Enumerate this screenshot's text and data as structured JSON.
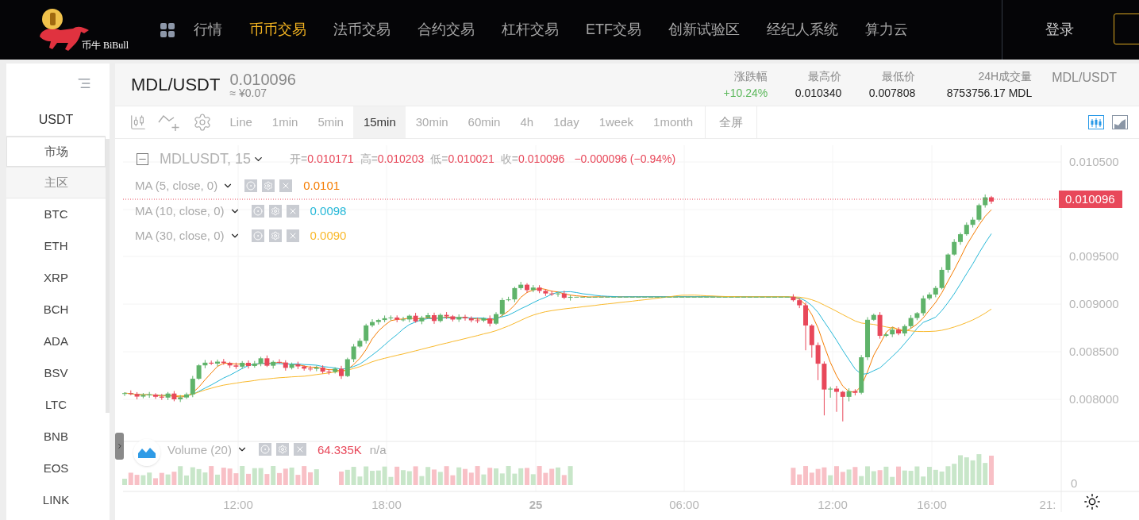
{
  "header": {
    "logo_text": "币牛 BiBull",
    "nav": [
      {
        "label": "行情",
        "selected": false
      },
      {
        "label": "币币交易",
        "selected": true
      },
      {
        "label": "法币交易",
        "selected": false
      },
      {
        "label": "合约交易",
        "selected": false
      },
      {
        "label": "杠杆交易",
        "selected": false
      },
      {
        "label": "ETF交易",
        "selected": false
      },
      {
        "label": "创新试验区",
        "selected": false
      },
      {
        "label": "经纪人系统",
        "selected": false
      },
      {
        "label": "算力云",
        "selected": false
      }
    ],
    "login": "登录"
  },
  "sidebar": {
    "quote": "USDT",
    "tabs": [
      {
        "label": "市场",
        "selected": true
      },
      {
        "label": "主区",
        "selected": false
      }
    ],
    "coins": [
      "BTC",
      "ETH",
      "XRP",
      "BCH",
      "ADA",
      "BSV",
      "LTC",
      "BNB",
      "EOS",
      "LINK"
    ]
  },
  "ticker": {
    "pair": "MDL/USDT",
    "price": "0.010096",
    "approx": "≈ ¥0.07",
    "stats": [
      {
        "label": "涨跌幅",
        "value": "+10.24%",
        "kind": "change"
      },
      {
        "label": "最高价",
        "value": "0.010340",
        "kind": "plain"
      },
      {
        "label": "最低价",
        "value": "0.007808",
        "kind": "plain"
      },
      {
        "label": "24H成交量",
        "value": "8753756.17 MDL",
        "kind": "plain"
      }
    ],
    "pair_label": "MDL/USDT"
  },
  "toolbar": {
    "intervals": [
      {
        "label": "Line",
        "selected": false
      },
      {
        "label": "1min",
        "selected": false
      },
      {
        "label": "5min",
        "selected": false
      },
      {
        "label": "15min",
        "selected": true
      },
      {
        "label": "30min",
        "selected": false
      },
      {
        "label": "60min",
        "selected": false
      },
      {
        "label": "4h",
        "selected": false
      },
      {
        "label": "1day",
        "selected": false
      },
      {
        "label": "1week",
        "selected": false
      },
      {
        "label": "1month",
        "selected": false
      }
    ],
    "fullscreen": "全屏",
    "chart_styles": [
      {
        "kind": "candles",
        "selected": true
      },
      {
        "kind": "area",
        "selected": false
      }
    ]
  },
  "chart": {
    "symbol": "MDLUSDT, 15",
    "ohlc": [
      {
        "label": "开=",
        "value": "0.010171"
      },
      {
        "label": "高=",
        "value": "0.010203"
      },
      {
        "label": "低=",
        "value": "0.010021"
      },
      {
        "label": "收=",
        "value": "0.010096"
      }
    ],
    "change": "−0.000096 (−0.94%)",
    "indicators": [
      {
        "label": "MA (5, close, 0)",
        "value": "0.0101",
        "color": "#f57c00"
      },
      {
        "label": "MA (10, close, 0)",
        "value": "0.0098",
        "color": "#26b8d8"
      },
      {
        "label": "MA (30, close, 0)",
        "value": "0.0090",
        "color": "#f9b92c"
      }
    ],
    "volume": {
      "label": "Volume (20)",
      "value": "64.335K",
      "extra": "n/a"
    },
    "price_ticks": [
      "0.010500",
      "0.009500",
      "0.009000",
      "0.008500",
      "0.008000"
    ],
    "last_price": "0.010096",
    "volume_tick": "0",
    "time_ticks": [
      {
        "label": "12:00",
        "bold": false
      },
      {
        "label": "18:00",
        "bold": false
      },
      {
        "label": "25",
        "bold": true
      },
      {
        "label": "06:00",
        "bold": false
      },
      {
        "label": "12:00",
        "bold": false
      },
      {
        "label": "16:00",
        "bold": false
      },
      {
        "label": "21:",
        "bold": false
      }
    ]
  }
}
